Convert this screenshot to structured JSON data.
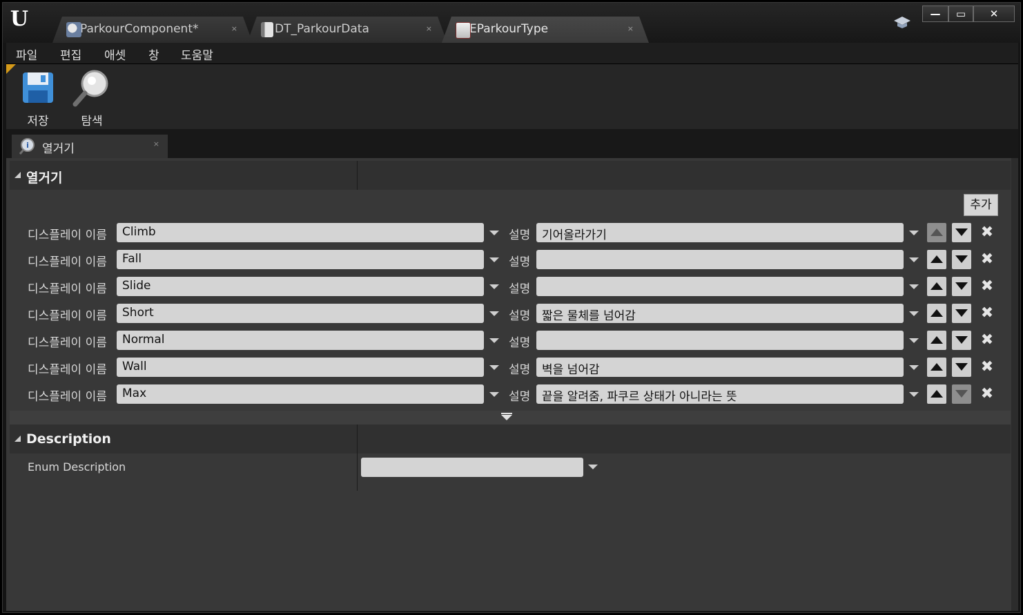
{
  "tabs": [
    {
      "label": "ParkourComponent*",
      "icon": "blueprint-icon"
    },
    {
      "label": "DT_ParkourData",
      "icon": "datatable-icon"
    },
    {
      "label": "EParkourType",
      "icon": "enum-icon"
    }
  ],
  "tab_close_glyph": "×",
  "window_controls": {
    "minimize": "—",
    "maximize": "▭",
    "close": "✕"
  },
  "menu": [
    "파일",
    "편집",
    "애셋",
    "창",
    "도움말"
  ],
  "toolbar": {
    "save_label": "저장",
    "browse_label": "탐색"
  },
  "details_tab": {
    "label": "열거기"
  },
  "enumerators_section": {
    "title": "열거기",
    "add_label": "추가",
    "display_name_label": "디스플레이 이름",
    "description_label": "설명",
    "items": [
      {
        "name": "Climb",
        "description": "기어올라가기"
      },
      {
        "name": "Fall",
        "description": ""
      },
      {
        "name": "Slide",
        "description": ""
      },
      {
        "name": "Short",
        "description": "짧은 물체를 넘어감"
      },
      {
        "name": "Normal",
        "description": ""
      },
      {
        "name": "Wall",
        "description": "벽을 넘어감"
      },
      {
        "name": "Max",
        "description": "끝을 알려줌, 파쿠르 상태가 아니라는 뜻"
      }
    ]
  },
  "description_section": {
    "title": "Description",
    "enum_description_label": "Enum Description",
    "enum_description_value": ""
  },
  "colors": {
    "accent": "#d49a1a",
    "field_bg": "#d4d4d4",
    "panel_bg": "#383838"
  }
}
